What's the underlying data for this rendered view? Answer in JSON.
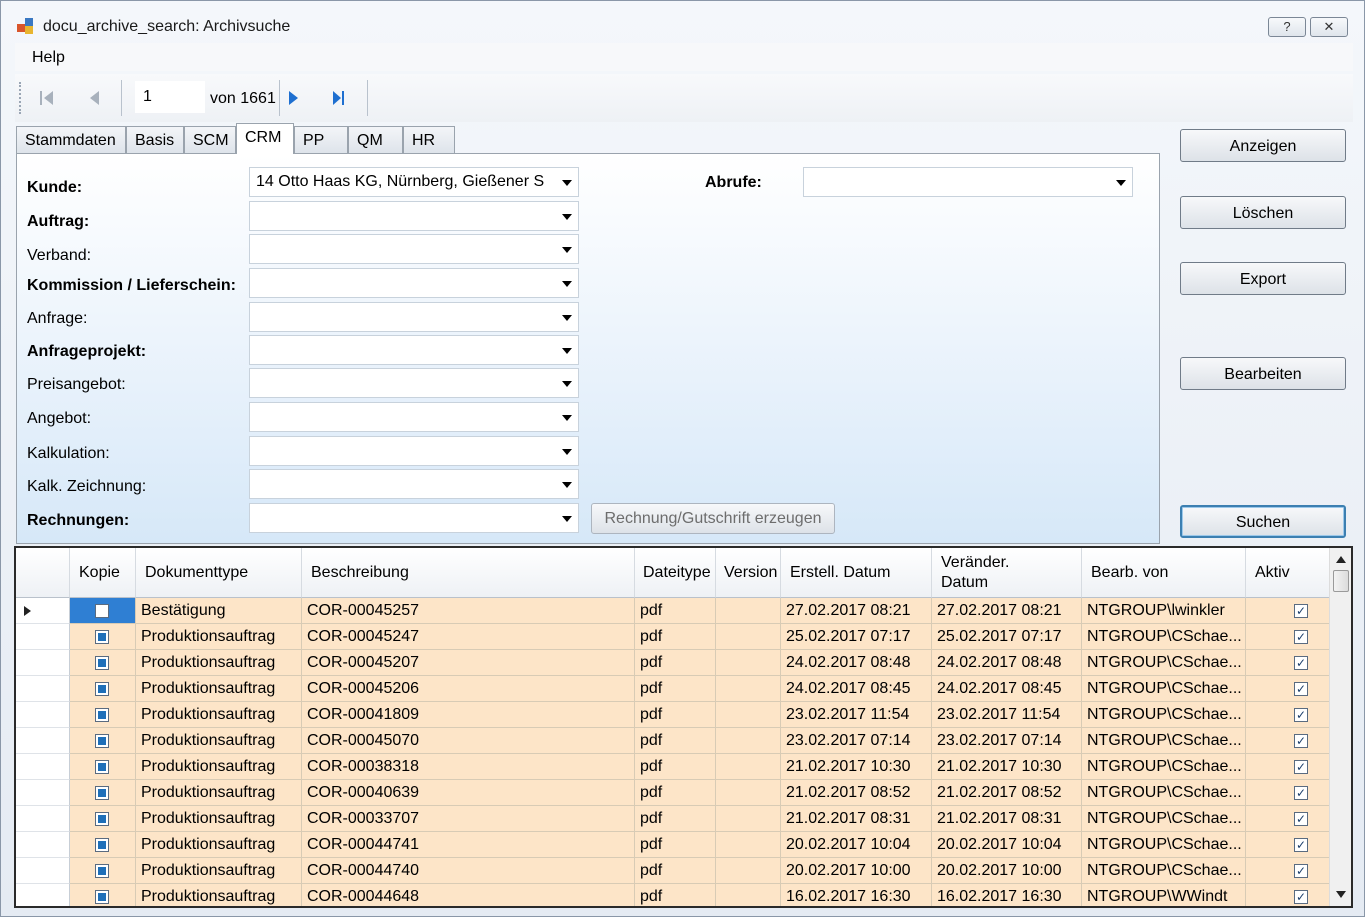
{
  "window": {
    "title": "docu_archive_search: Archivsuche",
    "help_btn": "?",
    "close_btn": "✕"
  },
  "menu": {
    "help": "Help"
  },
  "toolbar": {
    "page_value": "1",
    "of_label": "von 1661"
  },
  "tabs": [
    "Stammdaten",
    "Basis",
    "SCM",
    "CRM",
    "PP",
    "QM",
    "HR"
  ],
  "active_tab": "CRM",
  "form": {
    "kunde_label": "Kunde:",
    "kunde_value": "14     Otto Haas KG, Nürnberg, Gießener S",
    "abrufe_label": "Abrufe:",
    "auftrag_label": "Auftrag:",
    "verband_label": "Verband:",
    "kommission_label": "Kommission / Lieferschein:",
    "anfrage_label": "Anfrage:",
    "anfrageprojekt_label": "Anfrageprojekt:",
    "preisangebot_label": "Preisangebot:",
    "angebot_label": "Angebot:",
    "kalkulation_label": "Kalkulation:",
    "kalk_zeichnung_label": "Kalk. Zeichnung:",
    "rechnungen_label": "Rechnungen:",
    "rechnung_btn": "Rechnung/Gutschrift erzeugen"
  },
  "side_buttons": {
    "anzeigen": "Anzeigen",
    "loeschen": "Löschen",
    "export": "Export",
    "bearbeiten": "Bearbeiten",
    "suchen": "Suchen"
  },
  "grid": {
    "headers": [
      "Kopie",
      "Dokumenttype",
      "Beschreibung",
      "Dateitype",
      "Version",
      "Erstell. Datum",
      "Veränder.",
      "Datum",
      "Bearb. von",
      "Aktiv"
    ],
    "rows": [
      {
        "kopie": false,
        "typ": "Bestätigung",
        "beschreibung": "COR-00045257",
        "datei": "pdf",
        "version": "",
        "erstell": "27.02.2017 08:21",
        "veraender": "27.02.2017 08:21",
        "bearb": "NTGROUP\\lwinkler"
      },
      {
        "kopie": true,
        "typ": "Produktionsauftrag",
        "beschreibung": "COR-00045247",
        "datei": "pdf",
        "version": "",
        "erstell": "25.02.2017 07:17",
        "veraender": "25.02.2017 07:17",
        "bearb": "NTGROUP\\CSchae..."
      },
      {
        "kopie": true,
        "typ": "Produktionsauftrag",
        "beschreibung": "COR-00045207",
        "datei": "pdf",
        "version": "",
        "erstell": "24.02.2017 08:48",
        "veraender": "24.02.2017 08:48",
        "bearb": "NTGROUP\\CSchae..."
      },
      {
        "kopie": true,
        "typ": "Produktionsauftrag",
        "beschreibung": "COR-00045206",
        "datei": "pdf",
        "version": "",
        "erstell": "24.02.2017 08:45",
        "veraender": "24.02.2017 08:45",
        "bearb": "NTGROUP\\CSchae..."
      },
      {
        "kopie": true,
        "typ": "Produktionsauftrag",
        "beschreibung": "COR-00041809",
        "datei": "pdf",
        "version": "",
        "erstell": "23.02.2017 11:54",
        "veraender": "23.02.2017 11:54",
        "bearb": "NTGROUP\\CSchae..."
      },
      {
        "kopie": true,
        "typ": "Produktionsauftrag",
        "beschreibung": "COR-00045070",
        "datei": "pdf",
        "version": "",
        "erstell": "23.02.2017 07:14",
        "veraender": "23.02.2017 07:14",
        "bearb": "NTGROUP\\CSchae..."
      },
      {
        "kopie": true,
        "typ": "Produktionsauftrag",
        "beschreibung": "COR-00038318",
        "datei": "pdf",
        "version": "",
        "erstell": "21.02.2017 10:30",
        "veraender": "21.02.2017 10:30",
        "bearb": "NTGROUP\\CSchae..."
      },
      {
        "kopie": true,
        "typ": "Produktionsauftrag",
        "beschreibung": "COR-00040639",
        "datei": "pdf",
        "version": "",
        "erstell": "21.02.2017 08:52",
        "veraender": "21.02.2017 08:52",
        "bearb": "NTGROUP\\CSchae..."
      },
      {
        "kopie": true,
        "typ": "Produktionsauftrag",
        "beschreibung": "COR-00033707",
        "datei": "pdf",
        "version": "",
        "erstell": "21.02.2017 08:31",
        "veraender": "21.02.2017 08:31",
        "bearb": "NTGROUP\\CSchae..."
      },
      {
        "kopie": true,
        "typ": "Produktionsauftrag",
        "beschreibung": "COR-00044741",
        "datei": "pdf",
        "version": "",
        "erstell": "20.02.2017 10:04",
        "veraender": "20.02.2017 10:04",
        "bearb": "NTGROUP\\CSchae..."
      },
      {
        "kopie": true,
        "typ": "Produktionsauftrag",
        "beschreibung": "COR-00044740",
        "datei": "pdf",
        "version": "",
        "erstell": "20.02.2017 10:00",
        "veraender": "20.02.2017 10:00",
        "bearb": "NTGROUP\\CSchae..."
      },
      {
        "kopie": true,
        "typ": "Produktionsauftrag",
        "beschreibung": "COR-00044648",
        "datei": "pdf",
        "version": "",
        "erstell": "16.02.2017 16:30",
        "veraender": "16.02.2017 16:30",
        "bearb": "NTGROUP\\WWindt"
      }
    ]
  },
  "colors": {
    "row_bg": "#fde5c8",
    "accent": "#1f6fb8"
  }
}
